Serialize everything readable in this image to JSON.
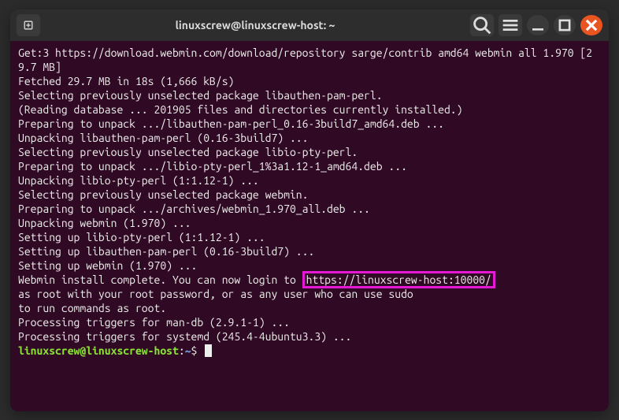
{
  "titlebar": {
    "title": "linuxscrew@linuxscrew-host: ~"
  },
  "output": {
    "l01": "Get:3 https://download.webmin.com/download/repository sarge/contrib amd64 webmin all 1.970 [29.7 MB]",
    "l02": "Fetched 29.7 MB in 18s (1,666 kB/s)",
    "l03": "Selecting previously unselected package libauthen-pam-perl.",
    "l04": "(Reading database ... 201905 files and directories currently installed.)",
    "l05": "Preparing to unpack .../libauthen-pam-perl_0.16-3build7_amd64.deb ...",
    "l06": "Unpacking libauthen-pam-perl (0.16-3build7) ...",
    "l07": "Selecting previously unselected package libio-pty-perl.",
    "l08": "Preparing to unpack .../libio-pty-perl_1%3a1.12-1_amd64.deb ...",
    "l09": "Unpacking libio-pty-perl (1:1.12-1) ...",
    "l10": "Selecting previously unselected package webmin.",
    "l11": "Preparing to unpack .../archives/webmin_1.970_all.deb ...",
    "l12": "Unpacking webmin (1.970) ...",
    "l13": "Setting up libio-pty-perl (1:1.12-1) ...",
    "l14": "Setting up libauthen-pam-perl (0.16-3build7) ...",
    "l15": "Setting up webmin (1.970) ...",
    "l16a": "Webmin install complete. You can now login to ",
    "l16b": "https://linuxscrew-host:10000/",
    "l17": "as root with your root password, or as any user who can use sudo",
    "l18": "to run commands as root.",
    "l19": "Processing triggers for man-db (2.9.1-1) ...",
    "l20": "Processing triggers for systemd (245.4-4ubuntu3.3) ..."
  },
  "prompt": {
    "userhost": "linuxscrew@linuxscrew-host",
    "sep": ":",
    "path": "~",
    "symbol": "$"
  }
}
